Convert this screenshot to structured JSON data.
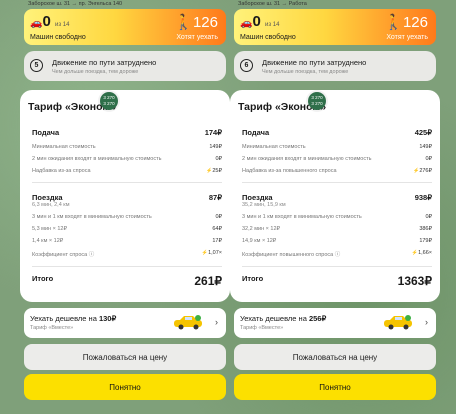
{
  "left": {
    "route": "Заборское ш. 31 → пр. Энгельса 140",
    "promo": {
      "free_icon": "car-icon",
      "free_count": "0",
      "free_of": "из 14",
      "free_label": "Машин свободно",
      "want_count": "126",
      "want_label": "Хотят уехать"
    },
    "traffic": {
      "icon": "traffic-speed-icon",
      "icon_text": "5",
      "title": "Движение по пути затруднено",
      "subtitle": "Чем дольше поездка, тем дороже"
    },
    "tariff": {
      "title": "Тариф «Эконом»",
      "badge_line1": "3 270",
      "badge_line2": "3 270",
      "pickup_label": "Подача",
      "pickup_value": "174₽",
      "pickup_items": [
        {
          "label": "Минимальная стоимость",
          "value": "149₽"
        },
        {
          "label": "2 мин ожидания входят в минимальную стоимость",
          "value": "0₽"
        },
        {
          "label": "Надбавка из-за спроса",
          "value": "25₽"
        }
      ],
      "ride_label": "Поездка",
      "ride_value": "87₽",
      "ride_sub": "6,3 мин, 2,4 км",
      "ride_items": [
        {
          "label": "3 мин и 1 км входят в минимальную стоимость",
          "value": "0₽"
        },
        {
          "label": "5,3 мин × 12₽",
          "value": "64₽"
        },
        {
          "label": "1,4 км × 12₽",
          "value": "17₽"
        },
        {
          "label": "Коэффициент спроса",
          "value": "1,07×"
        }
      ],
      "total_label": "Итого",
      "total_value": "261₽"
    },
    "cheaper": {
      "text": "Уехать дешевле на",
      "amount": "130₽",
      "sub": "Тариф «Вместе»"
    },
    "complain_label": "Пожаловаться на цену",
    "ok_label": "Понятно"
  },
  "right": {
    "route": "Заборское ш. 31 → Работа",
    "promo": {
      "free_icon": "car-icon",
      "free_count": "0",
      "free_of": "из 14",
      "free_label": "Машин свободно",
      "want_count": "126",
      "want_label": "Хотят уехать"
    },
    "traffic": {
      "icon": "traffic-speed-icon",
      "icon_text": "6",
      "title": "Движение по пути затруднено",
      "subtitle": "Чем дольше поездка, тем дороже"
    },
    "tariff": {
      "title": "Тариф «Эконом»",
      "badge_line1": "3 270",
      "badge_line2": "3 270",
      "pickup_label": "Подача",
      "pickup_value": "425₽",
      "pickup_items": [
        {
          "label": "Минимальная стоимость",
          "value": "149₽"
        },
        {
          "label": "2 мин ожидания входят в минимальную стоимость",
          "value": "0₽"
        },
        {
          "label": "Надбавка из-за повышенного спроса",
          "value": "276₽"
        }
      ],
      "ride_label": "Поездка",
      "ride_value": "938₽",
      "ride_sub": "35,2 мин, 15,9 км",
      "ride_items": [
        {
          "label": "3 мин и 1 км входят в минимальную стоимость",
          "value": "0₽"
        },
        {
          "label": "32,2 мин × 12₽",
          "value": "386₽"
        },
        {
          "label": "14,9 км × 12₽",
          "value": "179₽"
        },
        {
          "label": "Коэффициент повышенного спроса",
          "value": "1,66×"
        }
      ],
      "total_label": "Итого",
      "total_value": "1363₽"
    },
    "cheaper": {
      "text": "Уехать дешевле на",
      "amount": "256₽",
      "sub": "Тариф «Вместе»"
    },
    "complain_label": "Пожаловаться на цену",
    "ok_label": "Понятно"
  },
  "colors": {
    "promo_gradient_start": "#fff27a",
    "promo_gradient_end": "#ff7a1a",
    "ok_button": "#fce000",
    "badge": "#2f6f4a",
    "surge_accent": "#e8a700"
  }
}
